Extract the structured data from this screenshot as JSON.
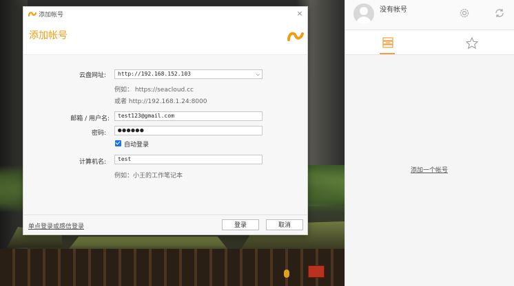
{
  "dialog": {
    "window_title": "添加帐号",
    "heading": "添加帐号",
    "close_symbol": "×",
    "server": {
      "label": "云盘网址:",
      "value": "http://192.168.152.103",
      "hint_1": "例如： https://seacloud.cc",
      "hint_2": "或者 http://192.168.1.24:8000"
    },
    "email": {
      "label": "邮箱 / 用户名:",
      "value": "test123@gmail.com"
    },
    "password": {
      "label": "密码:",
      "value": "●●●●●●"
    },
    "remember": {
      "label": "自动登录",
      "checked": true
    },
    "computer_name": {
      "label": "计算机名:",
      "value": "test",
      "hint": "例如：小王的工作笔记本"
    },
    "sso_link": "单点登录或感信登录",
    "login_button": "登录",
    "cancel_button": "取消"
  },
  "sidepanel": {
    "account_name": "没有帐号",
    "add_account_link": "添加一个帐号",
    "tabs": [
      {
        "icon": "repos-icon",
        "active": true
      },
      {
        "icon": "star-icon",
        "active": false
      }
    ]
  },
  "colors": {
    "accent": "#f39c12",
    "checkbox": "#1a73e8"
  }
}
